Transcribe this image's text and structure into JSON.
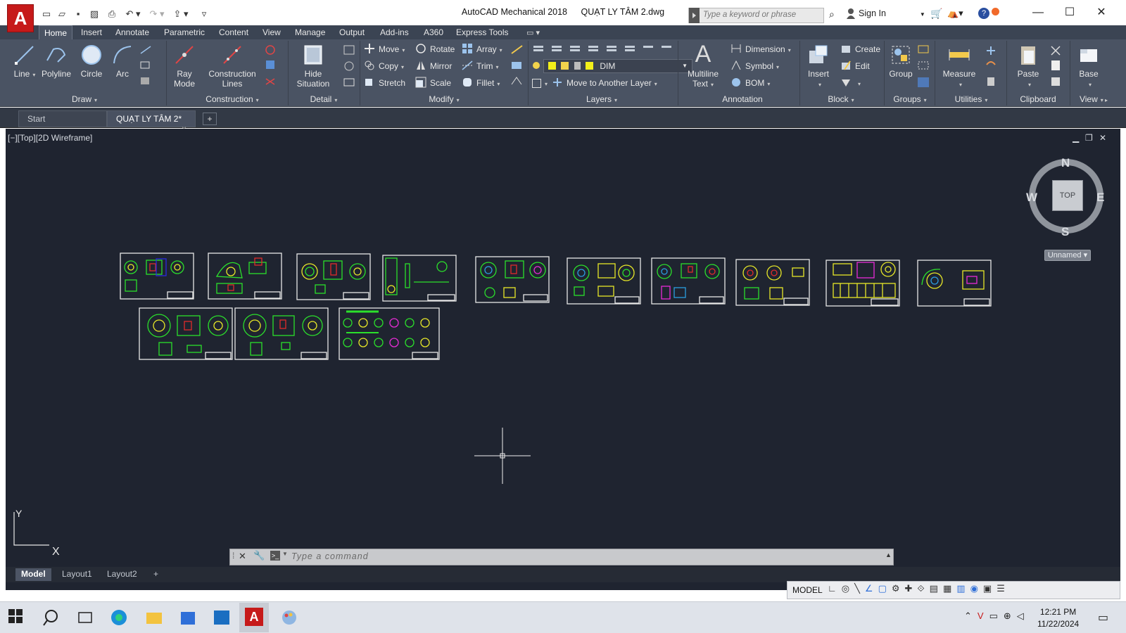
{
  "app": {
    "name": "AutoCAD Mechanical 2018",
    "document": "QUẠT LY TÂM 2.dwg",
    "search_placeholder": "Type a keyword or phrase",
    "sign_in": "Sign In",
    "logo_letter": "A"
  },
  "ribbon_tabs": [
    "Home",
    "Insert",
    "Annotate",
    "Parametric",
    "Content",
    "View",
    "Manage",
    "Output",
    "Add-ins",
    "A360",
    "Express Tools"
  ],
  "ribbon": {
    "draw": {
      "title": "Draw",
      "line": "Line",
      "polyline": "Polyline",
      "circle": "Circle",
      "arc": "Arc"
    },
    "construction": {
      "title": "Construction",
      "ray_mode_1": "Ray",
      "ray_mode_2": "Mode",
      "construction_lines_1": "Construction",
      "construction_lines_2": "Lines"
    },
    "detail": {
      "title": "Detail",
      "hide_situation_1": "Hide",
      "hide_situation_2": "Situation"
    },
    "modify": {
      "title": "Modify",
      "move": "Move",
      "rotate": "Rotate",
      "array": "Array",
      "copy": "Copy",
      "mirror": "Mirror",
      "trim": "Trim",
      "stretch": "Stretch",
      "scale": "Scale",
      "fillet": "Fillet"
    },
    "layers": {
      "title": "Layers",
      "current_layer": "DIM",
      "move_to_layer": "Move to Another Layer"
    },
    "annotation": {
      "title": "Annotation",
      "multiline_text_1": "Multiline",
      "multiline_text_2": "Text",
      "dimension": "Dimension",
      "symbol": "Symbol",
      "bom": "BOM"
    },
    "block": {
      "title": "Block",
      "insert": "Insert",
      "create": "Create",
      "edit": "Edit"
    },
    "groups": {
      "title": "Groups",
      "group": "Group"
    },
    "utilities": {
      "title": "Utilities",
      "measure": "Measure"
    },
    "clipboard": {
      "title": "Clipboard",
      "paste": "Paste"
    },
    "view": {
      "title": "View",
      "base": "Base"
    }
  },
  "doc_tabs": {
    "start": "Start",
    "active": "QUẠT LY TÂM 2*",
    "close": "×",
    "new": "+"
  },
  "viewport": {
    "label": "[−][Top][2D Wireframe]",
    "compass_n": "N",
    "compass_s": "S",
    "compass_e": "E",
    "compass_w": "W",
    "top_face": "TOP",
    "ucs_name": "Unnamed",
    "ucs_x": "X",
    "ucs_y": "Y"
  },
  "command": {
    "placeholder": "Type a command"
  },
  "layout_tabs": [
    "Model",
    "Layout1",
    "Layout2",
    "+"
  ],
  "status": {
    "model": "MODEL"
  },
  "taskbar": {
    "time": "12:21 PM",
    "date": "11/22/2024"
  },
  "colors": {
    "canvas": "#1f2430",
    "ribbon": "#4a5363",
    "accent": "#c61a1a"
  }
}
